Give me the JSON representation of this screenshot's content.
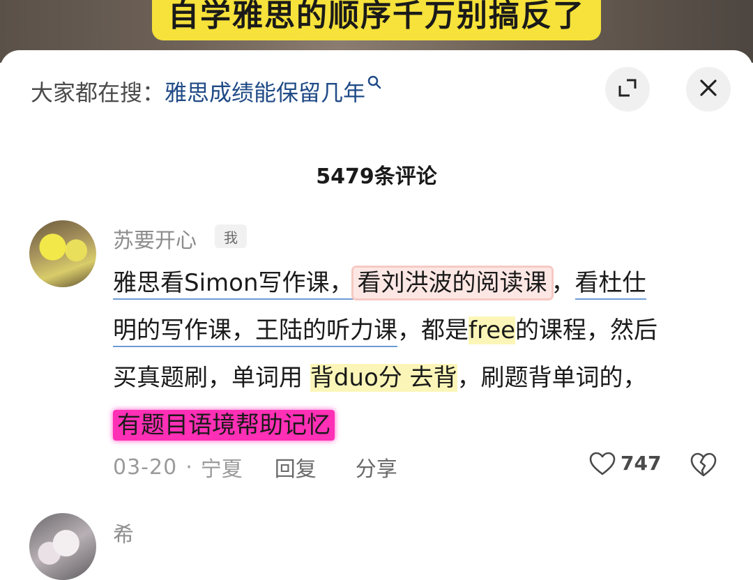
{
  "video": {
    "caption": "自学雅思的顺序千万别搞反了"
  },
  "header": {
    "search_prefix": "大家都在搜：",
    "search_term": "雅思成绩能保留几年",
    "search_icon": "search-icon",
    "expand_icon": "expand-icon",
    "close_icon": "close-icon"
  },
  "comment_count": "5479条评论",
  "comments": [
    {
      "username": "苏要开心",
      "badge": "我",
      "text_lines": [
        [
          "雅思看Simon写作课，",
          "看刘洪波的阅读课",
          "，",
          "看杜仕"
        ],
        [
          "明的写作课，王陆的听力课",
          "，都是",
          "free",
          "的课程，然后"
        ],
        [
          "买真题刷，单词用 ",
          "背duo分 去背",
          "，刷题背单词的，"
        ],
        [
          "有题目语境帮助记忆"
        ]
      ],
      "date": "03-20",
      "location": "宁夏",
      "reply_label": "回复",
      "share_label": "分享",
      "likes": "747"
    },
    {
      "username": "希"
    }
  ],
  "colors": {
    "search_term": "#1f4a86",
    "caption_bg": "#f6e23a",
    "underline_blue": "#6d9bd6",
    "highlight_red": "#fde7e4",
    "highlight_yellow": "#fbf6b8",
    "highlight_pink": "#ff2fb6"
  }
}
